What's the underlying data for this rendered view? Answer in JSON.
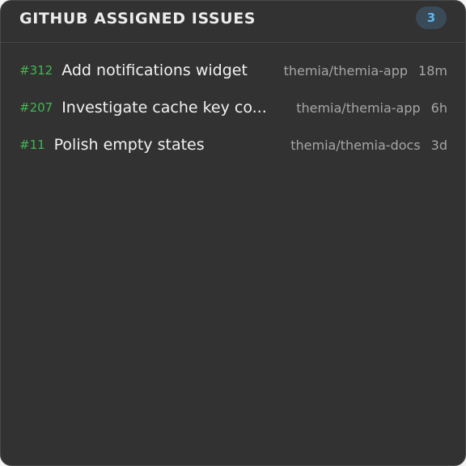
{
  "widget": {
    "title": "GITHUB ASSIGNED ISSUES",
    "count": "3"
  },
  "issues": [
    {
      "number": "#312",
      "title": "Add notifications widget",
      "repo": "themia/themia-app",
      "age": "18m"
    },
    {
      "number": "#207",
      "title": "Investigate cache key co...",
      "repo": "themia/themia-app",
      "age": "6h"
    },
    {
      "number": "#11",
      "title": "Polish empty states",
      "repo": "themia/themia-docs",
      "age": "3d"
    }
  ],
  "colors": {
    "background": "#323232",
    "issue_number": "#3fb950",
    "badge_text": "#5fb6ee",
    "badge_bg": "#3b4a57"
  }
}
